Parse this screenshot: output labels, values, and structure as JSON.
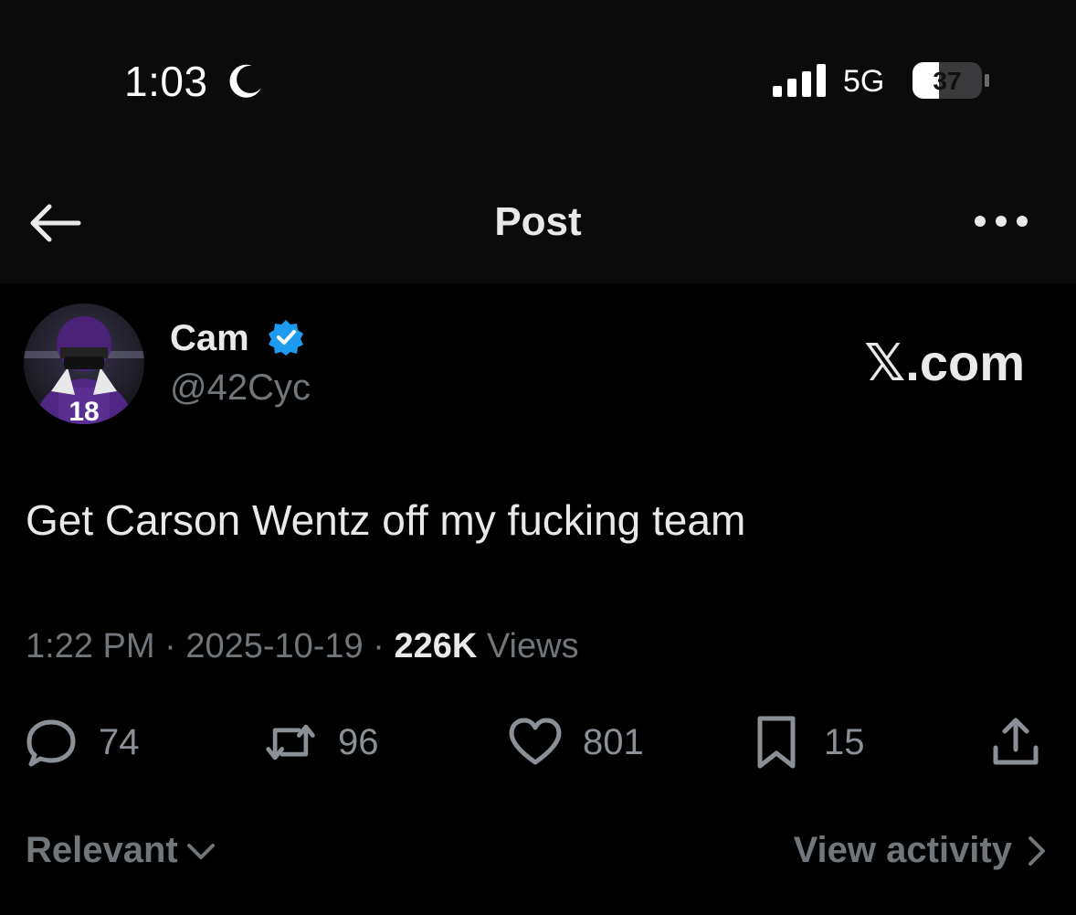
{
  "status_bar": {
    "time": "1:03",
    "network": "5G",
    "battery": "37"
  },
  "header": {
    "title": "Post"
  },
  "post": {
    "author_name": "Cam",
    "author_handle": "@42Cyc",
    "watermark": "𝕏.com",
    "text": "Get Carson Wentz off my fucking team",
    "time": "1:22 PM",
    "separator": "·",
    "date": "2025-10-19",
    "views_count": "226K",
    "views_label": "Views"
  },
  "actions": {
    "replies": "74",
    "reposts": "96",
    "likes": "801",
    "bookmarks": "15"
  },
  "footer": {
    "sort_label": "Relevant",
    "activity_label": "View activity"
  },
  "colors": {
    "background": "#000000",
    "text_primary": "#e7e9ea",
    "text_secondary": "#71767b",
    "verified_blue": "#1d9bf0",
    "vikings_purple": "#4f2683"
  }
}
